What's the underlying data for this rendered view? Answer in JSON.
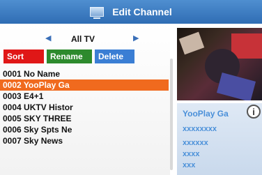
{
  "title": {
    "text": "Edit Channel",
    "icon": "tv-icon"
  },
  "group": {
    "label": "All TV"
  },
  "buttons": {
    "sort": "Sort",
    "rename": "Rename",
    "delete": "Delete"
  },
  "colors": {
    "sort": "#e01717",
    "rename": "#2d8a2d",
    "delete": "#3a7ed4",
    "selected": "#f06a1e",
    "title_bar": "#3a7ec4"
  },
  "channels": [
    {
      "label": "0001 No Name",
      "selected": false
    },
    {
      "label": "0002 YooPlay Ga",
      "selected": true
    },
    {
      "label": "0003 E4+1",
      "selected": false
    },
    {
      "label": "0004 UKTV Histor",
      "selected": false
    },
    {
      "label": "0005 SKY THREE",
      "selected": false
    },
    {
      "label": "0006 Sky Spts Ne",
      "selected": false
    },
    {
      "label": "0007 Sky News",
      "selected": false
    }
  ],
  "info": {
    "name": "YooPlay Ga",
    "lines": [
      "xxxxxxxx",
      "xxxxxx",
      "xxxx",
      "xxx"
    ]
  }
}
